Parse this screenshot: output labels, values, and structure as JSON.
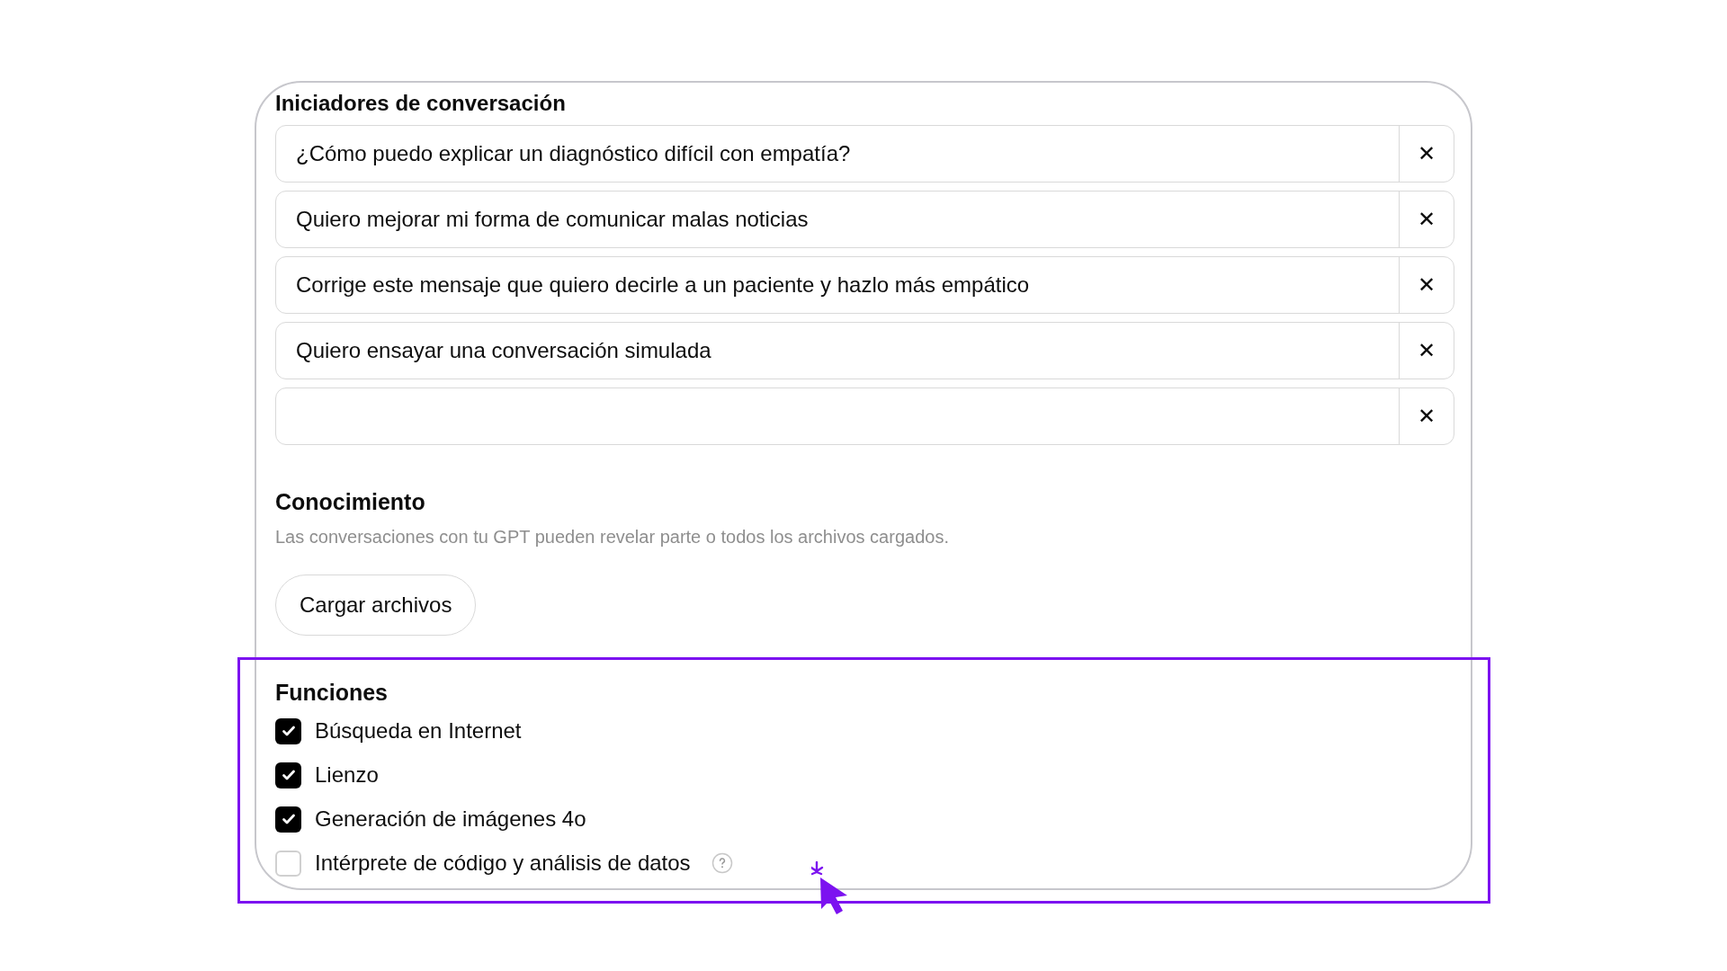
{
  "starters": {
    "title": "Iniciadores de conversación",
    "items": [
      {
        "value": "¿Cómo puedo explicar un diagnóstico difícil con empatía?"
      },
      {
        "value": "Quiero mejorar mi forma de comunicar malas noticias"
      },
      {
        "value": "Corrige este mensaje que quiero decirle a un paciente y hazlo más empático"
      },
      {
        "value": "Quiero ensayar una conversación simulada"
      },
      {
        "value": ""
      }
    ],
    "remove_label": "✕"
  },
  "knowledge": {
    "title": "Conocimiento",
    "description": "Las conversaciones con tu GPT pueden revelar parte o todos los archivos cargados.",
    "upload_button": "Cargar archivos"
  },
  "functions": {
    "title": "Funciones",
    "items": [
      {
        "label": "Búsqueda en Internet",
        "checked": true,
        "help": false
      },
      {
        "label": "Lienzo",
        "checked": true,
        "help": false
      },
      {
        "label": "Generación de imágenes 4o",
        "checked": true,
        "help": false
      },
      {
        "label": "Intérprete de código y análisis de datos",
        "checked": false,
        "help": true
      }
    ]
  }
}
